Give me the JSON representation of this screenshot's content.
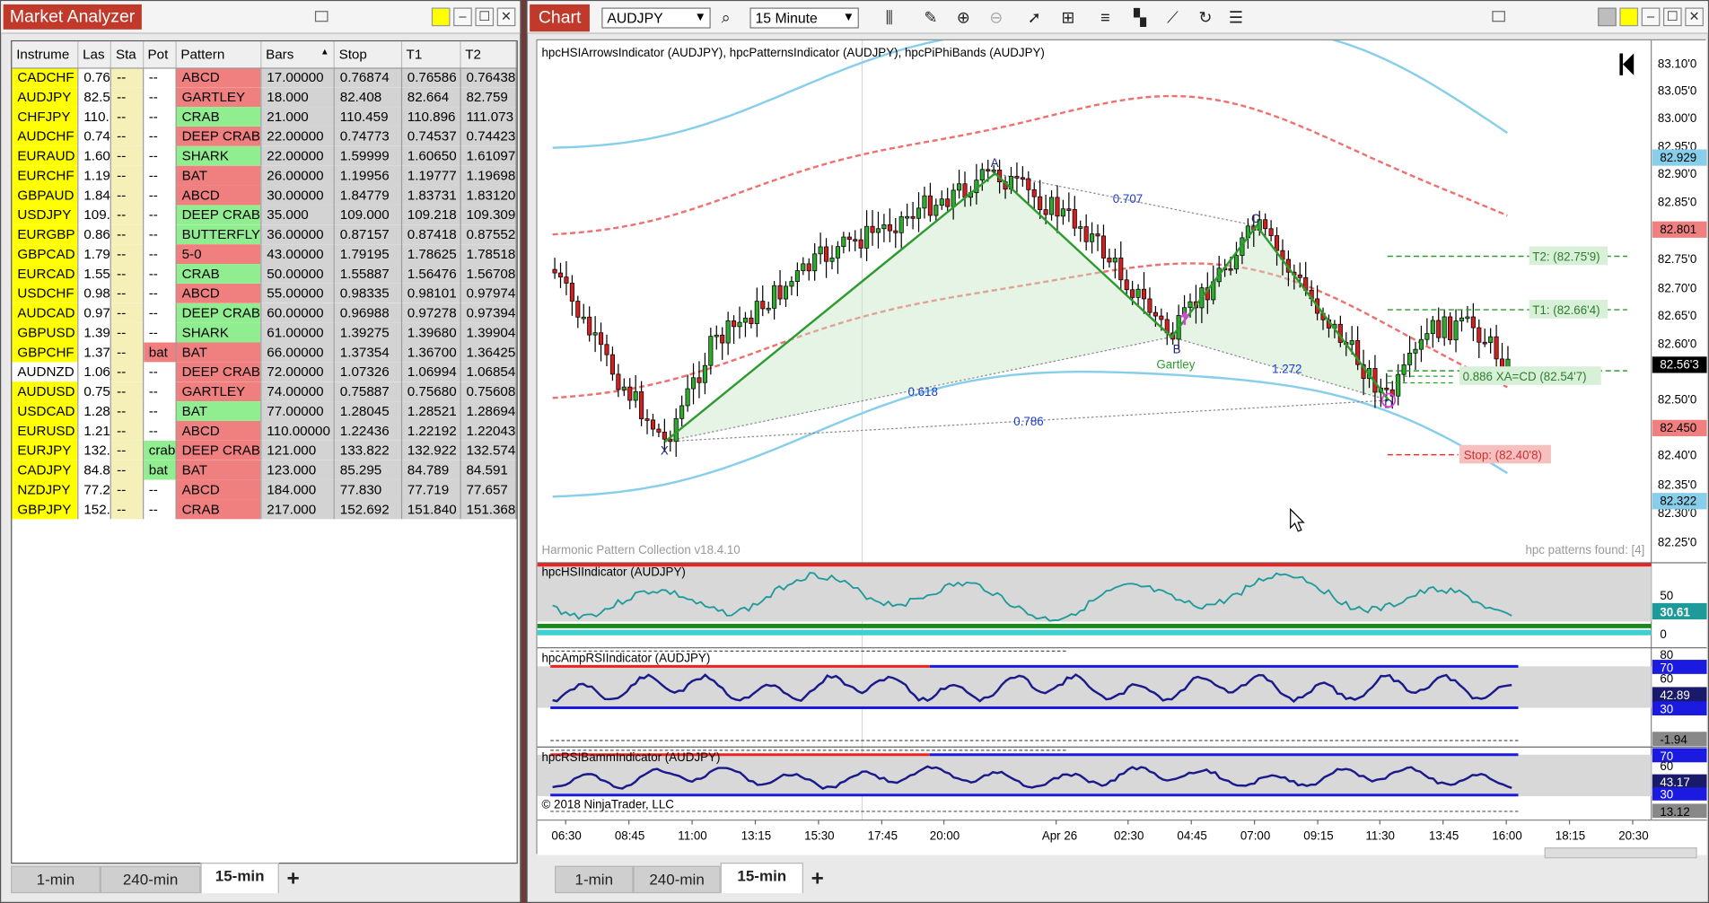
{
  "market_analyzer": {
    "title": "Market Analyzer",
    "columns": [
      "Instrume",
      "Las",
      "Sta",
      "Pot",
      "Pattern",
      "Bars",
      "Stop",
      "T1",
      "T2"
    ],
    "rows": [
      {
        "ins": "CADCHF",
        "last": "0.76",
        "sta": "--",
        "pot": "--",
        "pattern": "ABCD",
        "pcolor": "red",
        "bars": "17.00000",
        "stop": "0.76874",
        "t1": "0.76586",
        "t2": "0.76438"
      },
      {
        "ins": "AUDJPY",
        "last": "82.5",
        "sta": "--",
        "pot": "--",
        "pattern": "GARTLEY",
        "pcolor": "red",
        "bars": "18.000",
        "stop": "82.408",
        "t1": "82.664",
        "t2": "82.759"
      },
      {
        "ins": "CHFJPY",
        "last": "110.",
        "sta": "--",
        "pot": "--",
        "pattern": "CRAB",
        "pcolor": "green",
        "bars": "21.000",
        "stop": "110.459",
        "t1": "110.896",
        "t2": "111.073"
      },
      {
        "ins": "AUDCHF",
        "last": "0.74",
        "sta": "--",
        "pot": "--",
        "pattern": "DEEP CRAB",
        "pcolor": "red",
        "bars": "22.00000",
        "stop": "0.74773",
        "t1": "0.74537",
        "t2": "0.74423"
      },
      {
        "ins": "EURAUD",
        "last": "1.60",
        "sta": "--",
        "pot": "--",
        "pattern": "SHARK",
        "pcolor": "green",
        "bars": "22.00000",
        "stop": "1.59999",
        "t1": "1.60650",
        "t2": "1.61097"
      },
      {
        "ins": "EURCHF",
        "last": "1.19",
        "sta": "--",
        "pot": "--",
        "pattern": "BAT",
        "pcolor": "red",
        "bars": "26.00000",
        "stop": "1.19956",
        "t1": "1.19777",
        "t2": "1.19698"
      },
      {
        "ins": "GBPAUD",
        "last": "1.84",
        "sta": "--",
        "pot": "--",
        "pattern": "ABCD",
        "pcolor": "red",
        "bars": "30.00000",
        "stop": "1.84779",
        "t1": "1.83731",
        "t2": "1.83120"
      },
      {
        "ins": "USDJPY",
        "last": "109.",
        "sta": "--",
        "pot": "--",
        "pattern": "DEEP CRAB",
        "pcolor": "green",
        "bars": "35.000",
        "stop": "109.000",
        "t1": "109.218",
        "t2": "109.309"
      },
      {
        "ins": "EURGBP",
        "last": "0.86",
        "sta": "--",
        "pot": "--",
        "pattern": "BUTTERFLY",
        "pcolor": "green",
        "bars": "36.00000",
        "stop": "0.87157",
        "t1": "0.87418",
        "t2": "0.87552"
      },
      {
        "ins": "GBPCAD",
        "last": "1.79",
        "sta": "--",
        "pot": "--",
        "pattern": "5-0",
        "pcolor": "red",
        "bars": "43.00000",
        "stop": "1.79195",
        "t1": "1.78625",
        "t2": "1.78518"
      },
      {
        "ins": "EURCAD",
        "last": "1.55",
        "sta": "--",
        "pot": "--",
        "pattern": "CRAB",
        "pcolor": "green",
        "bars": "50.00000",
        "stop": "1.55887",
        "t1": "1.56476",
        "t2": "1.56708"
      },
      {
        "ins": "USDCHF",
        "last": "0.98",
        "sta": "--",
        "pot": "--",
        "pattern": "ABCD",
        "pcolor": "red",
        "bars": "55.00000",
        "stop": "0.98335",
        "t1": "0.98101",
        "t2": "0.97974"
      },
      {
        "ins": "AUDCAD",
        "last": "0.97",
        "sta": "--",
        "pot": "--",
        "pattern": "DEEP CRAB",
        "pcolor": "green",
        "bars": "60.00000",
        "stop": "0.96988",
        "t1": "0.97278",
        "t2": "0.97394"
      },
      {
        "ins": "GBPUSD",
        "last": "1.39",
        "sta": "--",
        "pot": "--",
        "pattern": "SHARK",
        "pcolor": "green",
        "bars": "61.00000",
        "stop": "1.39275",
        "t1": "1.39680",
        "t2": "1.39904"
      },
      {
        "ins": "GBPCHF",
        "last": "1.37",
        "sta": "--",
        "pot": "bat",
        "potcolor": "red",
        "pattern": "BAT",
        "pcolor": "red",
        "bars": "66.00000",
        "stop": "1.37354",
        "t1": "1.36700",
        "t2": "1.36425"
      },
      {
        "ins": "AUDNZD",
        "last": "1.06",
        "sta": "--",
        "pot": "--",
        "pattern": "DEEP CRAB",
        "pcolor": "red",
        "bars": "72.00000",
        "stop": "1.07326",
        "t1": "1.06994",
        "t2": "1.06854",
        "alt": true
      },
      {
        "ins": "AUDUSD",
        "last": "0.75",
        "sta": "--",
        "pot": "--",
        "pattern": "GARTLEY",
        "pcolor": "red",
        "bars": "74.00000",
        "stop": "0.75887",
        "t1": "0.75680",
        "t2": "0.75608"
      },
      {
        "ins": "USDCAD",
        "last": "1.28",
        "sta": "--",
        "pot": "--",
        "pattern": "BAT",
        "pcolor": "green",
        "bars": "77.00000",
        "stop": "1.28045",
        "t1": "1.28521",
        "t2": "1.28694"
      },
      {
        "ins": "EURUSD",
        "last": "1.21",
        "sta": "--",
        "pot": "--",
        "pattern": "ABCD",
        "pcolor": "red",
        "bars": "110.00000",
        "stop": "1.22436",
        "t1": "1.22192",
        "t2": "1.22043"
      },
      {
        "ins": "EURJPY",
        "last": "132.",
        "sta": "--",
        "pot": "crab",
        "potcolor": "green",
        "pattern": "DEEP CRAB",
        "pcolor": "red",
        "bars": "121.000",
        "stop": "133.822",
        "t1": "132.922",
        "t2": "132.574"
      },
      {
        "ins": "CADJPY",
        "last": "84.8",
        "sta": "--",
        "pot": "bat",
        "potcolor": "green",
        "pattern": "BAT",
        "pcolor": "red",
        "bars": "123.000",
        "stop": "85.295",
        "t1": "84.789",
        "t2": "84.591"
      },
      {
        "ins": "NZDJPY",
        "last": "77.2",
        "sta": "--",
        "pot": "--",
        "pattern": "ABCD",
        "pcolor": "red",
        "bars": "184.000",
        "stop": "77.830",
        "t1": "77.719",
        "t2": "77.657"
      },
      {
        "ins": "GBPJPY",
        "last": "152.",
        "sta": "--",
        "pot": "--",
        "pattern": "CRAB",
        "pcolor": "red",
        "bars": "217.000",
        "stop": "152.692",
        "t1": "151.840",
        "t2": "151.368"
      }
    ],
    "tabs": [
      "1-min",
      "240-min",
      "15-min"
    ],
    "active_tab": "15-min",
    "add_tab": "+"
  },
  "chart": {
    "title": "Chart",
    "instrument": "AUDJPY",
    "interval": "15 Minute",
    "indicator_header": "hpcHSIArrowsIndicator (AUDJPY), hpcPatternsIndicator (AUDJPY), hpcPiPhiBands (AUDJPY)",
    "footer_left": "Harmonic Pattern Collection v18.4.10",
    "footer_right": "hpc patterns found: [4]",
    "pattern_name": "Gartley",
    "points": {
      "x": "X",
      "a": "A",
      "b": "B",
      "c": "C",
      "d": "D"
    },
    "ratios": {
      "xb": "0.618",
      "ac": "0.707",
      "bd": "1.272",
      "xd": "0.786"
    },
    "levels": {
      "t2": "T2: (82.75'9)",
      "t1": "T1: (82.66'4)",
      "cd": "0.886 XA=CD (82.54'7)",
      "stop": "Stop: (82.40'8)"
    },
    "price_axis": [
      "83.10'0",
      "83.05'0",
      "83.00'0",
      "82.95'0",
      "82.90'0",
      "82.85'0",
      "82.75'0",
      "82.70'0",
      "82.65'0",
      "82.60'0",
      "82.50'0",
      "82.40'0",
      "82.35'0",
      "82.30'0",
      "82.25'0"
    ],
    "price_markers": [
      {
        "label": "82.929",
        "color": "#87ceeb",
        "text": "#000"
      },
      {
        "label": "82.801",
        "color": "#f08080",
        "text": "#000"
      },
      {
        "label": "82.56'3",
        "color": "#000000",
        "text": "#fff"
      },
      {
        "label": "82.450",
        "color": "#f08080",
        "text": "#000"
      },
      {
        "label": "82.322",
        "color": "#87ceeb",
        "text": "#000"
      }
    ],
    "panel1": {
      "title": "hpcHSIIndicator (AUDJPY)",
      "axis": [
        "50",
        "0"
      ],
      "marker": "30.61"
    },
    "panel2": {
      "title": "hpcAmpRSIIndicator (AUDJPY)",
      "axis": [
        "80",
        "60"
      ],
      "markers": [
        "70",
        "42.89",
        "30",
        "-1.94"
      ]
    },
    "panel3": {
      "title": "hpcRSIBammIndicator (AUDJPY)",
      "axis": [
        "60"
      ],
      "markers": [
        "70",
        "43.17",
        "30",
        "13.12"
      ]
    },
    "copyright": "© 2018 NinjaTrader, LLC",
    "time_axis": [
      "06:30",
      "08:45",
      "11:00",
      "13:15",
      "15:30",
      "17:45",
      "20:00",
      "Apr 26",
      "02:30",
      "04:45",
      "07:00",
      "09:15",
      "11:30",
      "13:45",
      "16:00",
      "18:15",
      "20:30"
    ],
    "tabs": [
      "1-min",
      "240-min",
      "15-min"
    ],
    "active_tab": "15-min",
    "add_tab": "+"
  }
}
